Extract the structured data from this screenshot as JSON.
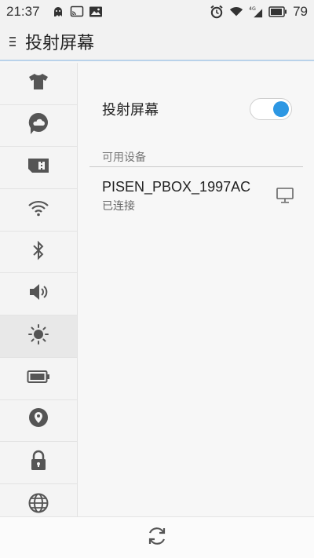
{
  "status_bar": {
    "time": "21:37",
    "battery_level": "79",
    "network_label": "4G"
  },
  "header": {
    "title": "投射屏幕"
  },
  "sidebar": {
    "items": [
      {
        "icon": "theme-shirt-icon"
      },
      {
        "icon": "cloud-account-icon"
      },
      {
        "icon": "sim-card-icon"
      },
      {
        "icon": "wifi-icon"
      },
      {
        "icon": "bluetooth-icon"
      },
      {
        "icon": "volume-icon"
      },
      {
        "icon": "brightness-icon",
        "active": true
      },
      {
        "icon": "battery-icon"
      },
      {
        "icon": "location-icon"
      },
      {
        "icon": "lock-icon"
      },
      {
        "icon": "globe-icon"
      }
    ]
  },
  "main": {
    "screen_cast": {
      "label": "投射屏幕",
      "enabled": true
    },
    "available_devices_label": "可用设备",
    "devices": [
      {
        "name": "PISEN_PBOX_1997AC",
        "status": "已连接",
        "icon": "monitor-icon"
      }
    ]
  },
  "bottom_bar": {
    "icon": "refresh-icon"
  },
  "colors": {
    "accent": "#2d97e3",
    "header_border": "#b9d2ea",
    "icon_gray": "#555555"
  }
}
